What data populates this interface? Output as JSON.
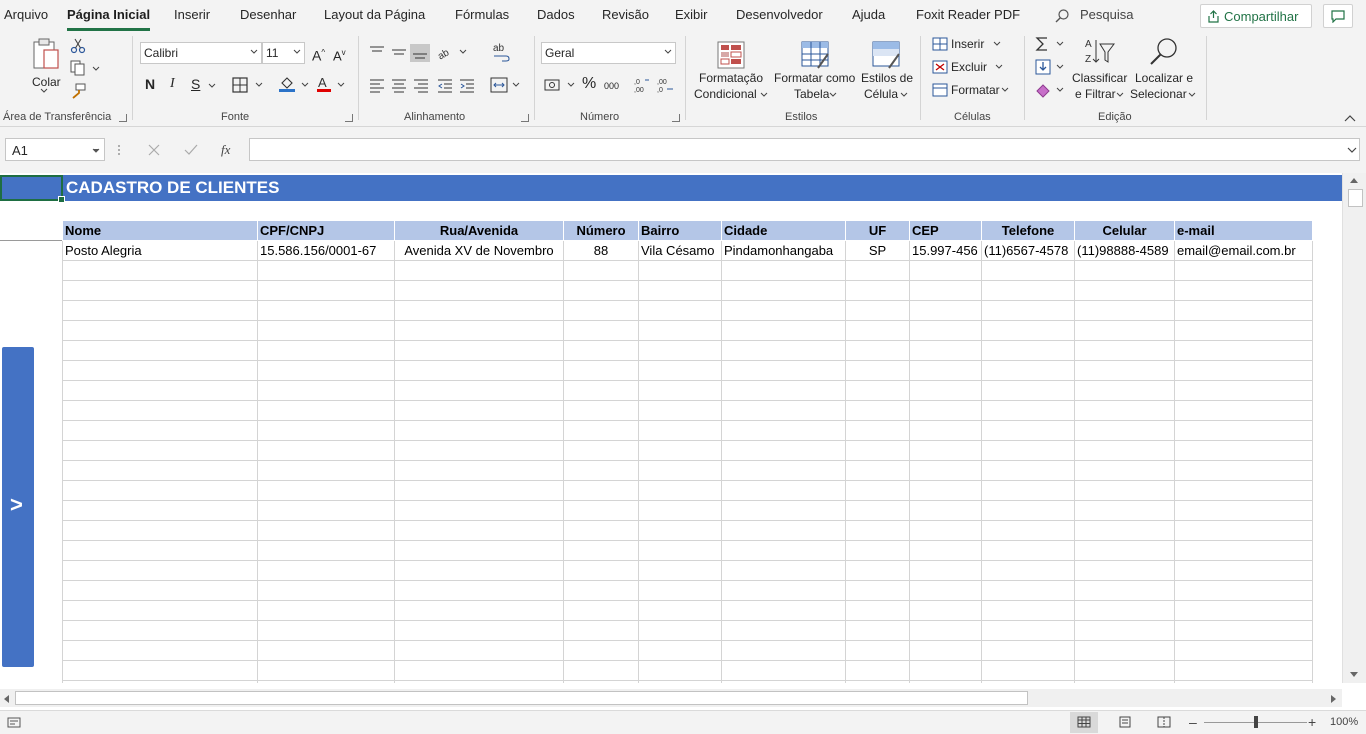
{
  "menu": {
    "tabs": [
      "Arquivo",
      "Página Inicial",
      "Inserir",
      "Desenhar",
      "Layout da Página",
      "Fórmulas",
      "Dados",
      "Revisão",
      "Exibir",
      "Desenvolvedor",
      "Ajuda",
      "Foxit Reader PDF"
    ],
    "active_tab": "Página Inicial",
    "search_placeholder": "Pesquisa",
    "share_label": "Compartilhar"
  },
  "ribbon": {
    "clipboard": {
      "paste_label": "Colar",
      "group_label": "Área de Transferência"
    },
    "font": {
      "font_name": "Calibri",
      "font_size": "11",
      "bold": "N",
      "italic": "I",
      "underline": "S",
      "group_label": "Fonte"
    },
    "alignment": {
      "group_label": "Alinhamento"
    },
    "number": {
      "format": "Geral",
      "group_label": "Número"
    },
    "styles": {
      "conditional_line1": "Formatação",
      "conditional_line2": "Condicional",
      "as_table_line1": "Formatar como",
      "as_table_line2": "Tabela",
      "cell_styles_line1": "Estilos de",
      "cell_styles_line2": "Célula",
      "group_label": "Estilos"
    },
    "cells": {
      "insert": "Inserir",
      "delete": "Excluir",
      "format": "Formatar",
      "group_label": "Células"
    },
    "editing": {
      "sort_line1": "Classificar",
      "sort_line2": "e Filtrar",
      "find_line1": "Localizar e",
      "find_line2": "Selecionar",
      "group_label": "Edição"
    }
  },
  "formula_bar": {
    "name_box": "A1",
    "fx": "fx",
    "formula": ""
  },
  "sheet": {
    "title": "CADASTRO DE CLIENTES",
    "side_button": ">",
    "headers": [
      "Nome",
      "CPF/CNPJ",
      "Rua/Avenida",
      "Número",
      "Bairro",
      "Cidade",
      "UF",
      "CEP",
      "Telefone",
      "Celular",
      "e-mail"
    ],
    "rows": [
      [
        "Posto Alegria",
        "15.586.156/0001-67",
        "Avenida XV de Novembro",
        "88",
        "Vila Césamo",
        "Pindamonhangaba",
        "SP",
        "15.997-456",
        "(11)6567-4578",
        "(11)98888-4589",
        "email@email.com.br"
      ]
    ]
  },
  "status_bar": {
    "zoom": "100%",
    "zoom_level": 1.0
  },
  "colors": {
    "accent": "#217346",
    "table_band": "#4472c4",
    "header_fill": "#b4c6e7"
  }
}
